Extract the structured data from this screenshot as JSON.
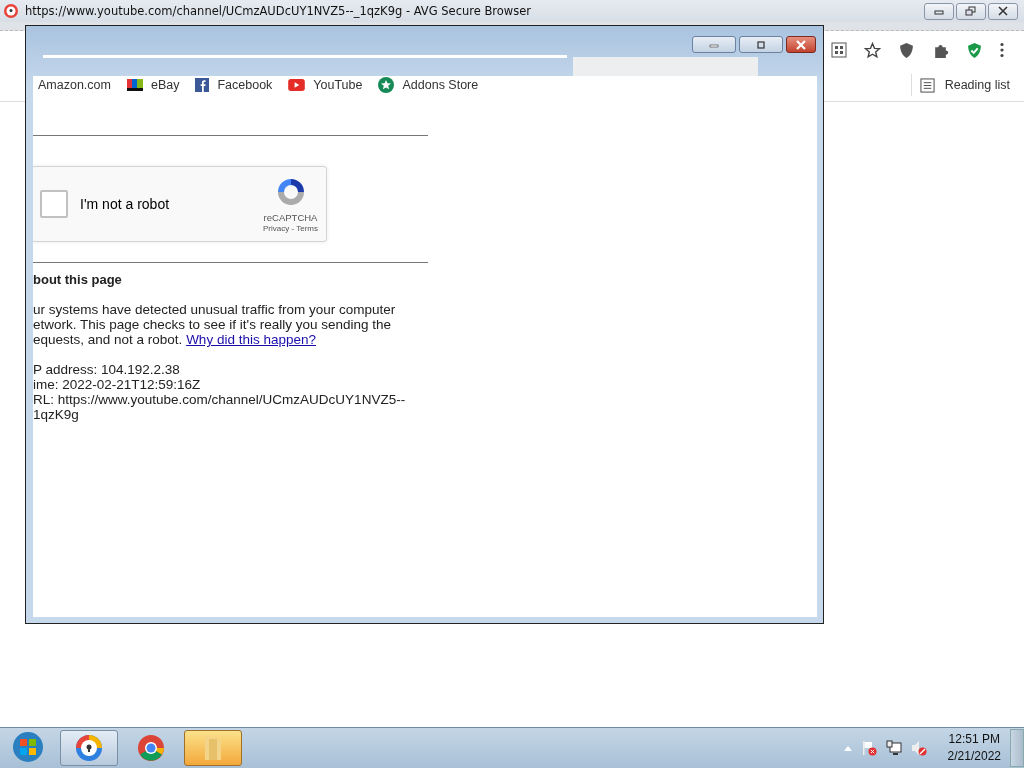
{
  "browser": {
    "title": "https://www.youtube.com/channel/UCmzAUDcUY1NVZ5--_1qzK9g - AVG Secure Browser",
    "reading_list": "Reading list"
  },
  "popup": {
    "bookmarks": [
      {
        "label": "Amazon.com",
        "kind": "plain"
      },
      {
        "label": "eBay",
        "kind": "ebay"
      },
      {
        "label": "Facebook",
        "kind": "facebook"
      },
      {
        "label": "YouTube",
        "kind": "youtube"
      },
      {
        "label": "Addons Store",
        "kind": "addons"
      }
    ],
    "captcha": {
      "label": "I'm not a robot",
      "checked": false,
      "brand": "reCAPTCHA",
      "links": "Privacy - Terms"
    },
    "about": {
      "heading": "bout this page",
      "lines": [
        "ur systems have detected unusual traffic from your computer",
        "etwork. This page checks to see if it's really you sending the",
        "equests, and not a robot."
      ],
      "link": "Why did this happen?"
    },
    "info": [
      "P address: 104.192.2.38",
      "ime: 2022-02-21T12:59:16Z",
      "RL: https://www.youtube.com/channel/UCmzAUDcUY1NVZ5--",
      "1qzK9g"
    ]
  },
  "taskbar": {
    "apps": [
      {
        "kind": "avg",
        "open": true,
        "selected": false
      },
      {
        "kind": "chrome",
        "open": false,
        "selected": false
      },
      {
        "kind": "folder",
        "open": true,
        "selected": true
      }
    ],
    "clock": {
      "time": "12:51 PM",
      "date": "2/21/2022"
    }
  }
}
